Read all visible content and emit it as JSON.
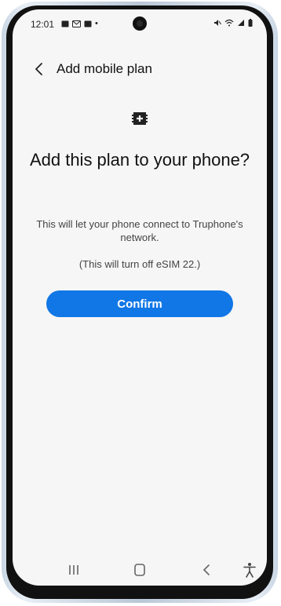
{
  "status_bar": {
    "time": "12:01",
    "dot": "•"
  },
  "header": {
    "title": "Add mobile plan"
  },
  "main": {
    "headline": "Add this plan to your phone?",
    "description": "This will let your phone connect to Truphone's network.",
    "note": "(This will turn off eSIM 22.)",
    "confirm_label": "Confirm"
  },
  "colors": {
    "accent": "#1177e6",
    "background": "#f6f6f6"
  },
  "icons": {
    "back": "chevron-left-icon",
    "sim": "sim-add-icon",
    "nav_recents": "recents-icon",
    "nav_home": "home-icon",
    "nav_back": "back-icon",
    "accessibility": "accessibility-icon"
  }
}
